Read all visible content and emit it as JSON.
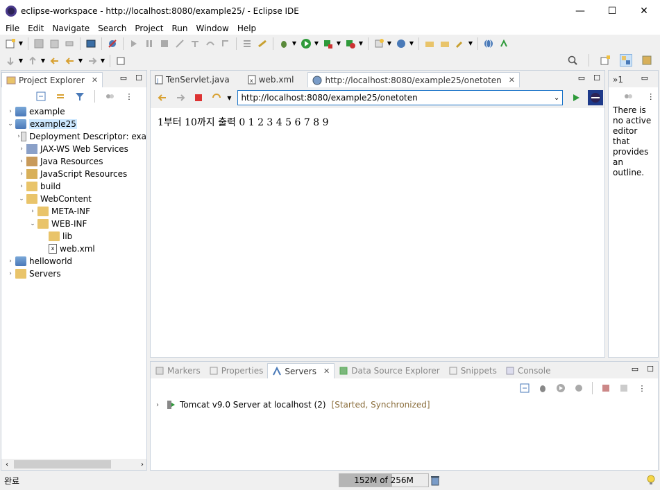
{
  "window": {
    "title": "eclipse-workspace - http://localhost:8080/example25/ - Eclipse IDE",
    "minimize": "—",
    "maximize": "☐",
    "close": "✕"
  },
  "menubar": [
    "File",
    "Edit",
    "Navigate",
    "Search",
    "Project",
    "Run",
    "Window",
    "Help"
  ],
  "project_explorer": {
    "title": "Project Explorer",
    "tree": [
      {
        "label": "example",
        "indent": 0,
        "arrow": "›",
        "icon": "project-icon"
      },
      {
        "label": "example25",
        "indent": 0,
        "arrow": "⌄",
        "icon": "project-icon",
        "selected": true
      },
      {
        "label": "Deployment Descriptor: exa",
        "indent": 1,
        "arrow": "›",
        "icon": "descriptor-icon"
      },
      {
        "label": "JAX-WS Web Services",
        "indent": 1,
        "arrow": "›",
        "icon": "webservice-icon"
      },
      {
        "label": "Java Resources",
        "indent": 1,
        "arrow": "›",
        "icon": "java-resources-icon"
      },
      {
        "label": "JavaScript Resources",
        "indent": 1,
        "arrow": "›",
        "icon": "javascript-resources-icon"
      },
      {
        "label": "build",
        "indent": 1,
        "arrow": "›",
        "icon": "folder-icon"
      },
      {
        "label": "WebContent",
        "indent": 1,
        "arrow": "⌄",
        "icon": "folder-icon"
      },
      {
        "label": "META-INF",
        "indent": 2,
        "arrow": "›",
        "icon": "folder-icon"
      },
      {
        "label": "WEB-INF",
        "indent": 2,
        "arrow": "⌄",
        "icon": "folder-icon"
      },
      {
        "label": "lib",
        "indent": 3,
        "arrow": "",
        "icon": "folder-icon"
      },
      {
        "label": "web.xml",
        "indent": 3,
        "arrow": "",
        "icon": "xml-file-icon"
      },
      {
        "label": "helloworld",
        "indent": 0,
        "arrow": "›",
        "icon": "project-icon"
      },
      {
        "label": "Servers",
        "indent": 0,
        "arrow": "›",
        "icon": "folder-icon"
      }
    ]
  },
  "editor": {
    "tabs": [
      {
        "label": "TenServlet.java",
        "icon": "java-file-icon",
        "active": false
      },
      {
        "label": "web.xml",
        "icon": "xml-file-icon",
        "active": false
      },
      {
        "label": "http://localhost:8080/example25/onetoten",
        "icon": "globe-icon",
        "active": true
      }
    ],
    "url": "http://localhost:8080/example25/onetoten",
    "page_content": "1부터 10까지 출력 0 1 2 3 4 5 6 7 8 9"
  },
  "outline": {
    "tab_label": "»1",
    "message": "There is no active editor that provides an outline."
  },
  "bottom_panel": {
    "tabs": [
      {
        "label": "Markers",
        "icon": "markers-icon",
        "active": false
      },
      {
        "label": "Properties",
        "icon": "properties-icon",
        "active": false
      },
      {
        "label": "Servers",
        "icon": "servers-icon",
        "active": true
      },
      {
        "label": "Data Source Explorer",
        "icon": "datasource-icon",
        "active": false
      },
      {
        "label": "Snippets",
        "icon": "snippets-icon",
        "active": false
      },
      {
        "label": "Console",
        "icon": "console-icon",
        "active": false
      }
    ],
    "server": {
      "name": "Tomcat v9.0 Server at localhost  (2)",
      "status": "[Started, Synchronized]"
    }
  },
  "statusbar": {
    "left_text": "완료",
    "heap_label": "152M of 256M",
    "heap_used_fraction": 0.59
  },
  "colors": {
    "accent": "#1a73c8",
    "status_text": "#8a6d3b",
    "selection": "#cde8ff"
  }
}
